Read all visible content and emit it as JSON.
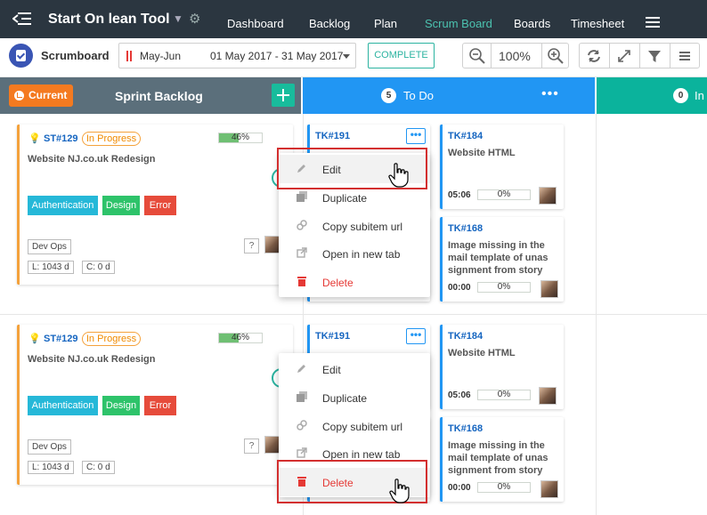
{
  "app": {
    "title": "Start On lean Tool",
    "nav": [
      "Dashboard",
      "Backlog",
      "Plan",
      "Scrum Board",
      "Boards",
      "Timesheet"
    ],
    "active_nav": "Scrum Board"
  },
  "toolbar": {
    "title": "Scrumboard",
    "sprint_name": "May-Jun",
    "sprint_dates": "01 May 2017 - 31 May 2017",
    "complete_label": "COMPLETE",
    "zoom": "100%"
  },
  "columns": {
    "sprint": {
      "badge": "Current",
      "title": "Sprint Backlog"
    },
    "todo": {
      "count": "5",
      "label": "To Do",
      "more": "•••"
    },
    "inprog": {
      "count": "0",
      "label": "In"
    }
  },
  "stories": [
    {
      "id": "ST#129",
      "status": "In Progress",
      "progress": "46%",
      "progress_value": 46,
      "title": "Website NJ.co.uk Redesign",
      "tags": [
        "Authentication",
        "Design",
        "Error"
      ],
      "team": "Dev Ops",
      "help": "?",
      "metric_l": "L: 1043 d",
      "metric_c": "C: 0 d"
    },
    {
      "id": "ST#129",
      "status": "In Progress",
      "progress": "46%",
      "progress_value": 46,
      "title": "Website NJ.co.uk Redesign",
      "tags": [
        "Authentication",
        "Design",
        "Error"
      ],
      "team": "Dev Ops",
      "help": "?",
      "metric_l": "L: 1043 d",
      "metric_c": "C: 0 d"
    }
  ],
  "tasks": [
    {
      "id": "TK#191",
      "more": "•••"
    },
    {
      "id": "TK#184",
      "title": "Website HTML",
      "time": "05:06",
      "progress": "0%"
    },
    {
      "id": "TK#168",
      "title_lines": [
        "Image missing in the",
        "mail template of unas",
        "signment from story"
      ],
      "time": "00:00",
      "progress": "0%"
    },
    {
      "id": "TK#191",
      "more": "•••"
    },
    {
      "id": "TK#184",
      "title": "Website HTML",
      "time": "05:06",
      "progress": "0%"
    },
    {
      "id": "TK#168",
      "title_lines": [
        "Image missing in the",
        "mail template of unas",
        "signment from story"
      ],
      "time": "00:00",
      "progress": "0%"
    }
  ],
  "context_menu": [
    "Edit",
    "Duplicate",
    "Copy subitem url",
    "Open in new tab",
    "Delete"
  ],
  "colors": {
    "nav_bg": "#2b3640",
    "accent": "#2bb3a0",
    "todo": "#2196f3",
    "sprint": "#5b6f7b",
    "inprog": "#0bb39c",
    "current": "#f47a20",
    "highlight_box": "#d32f2f"
  }
}
